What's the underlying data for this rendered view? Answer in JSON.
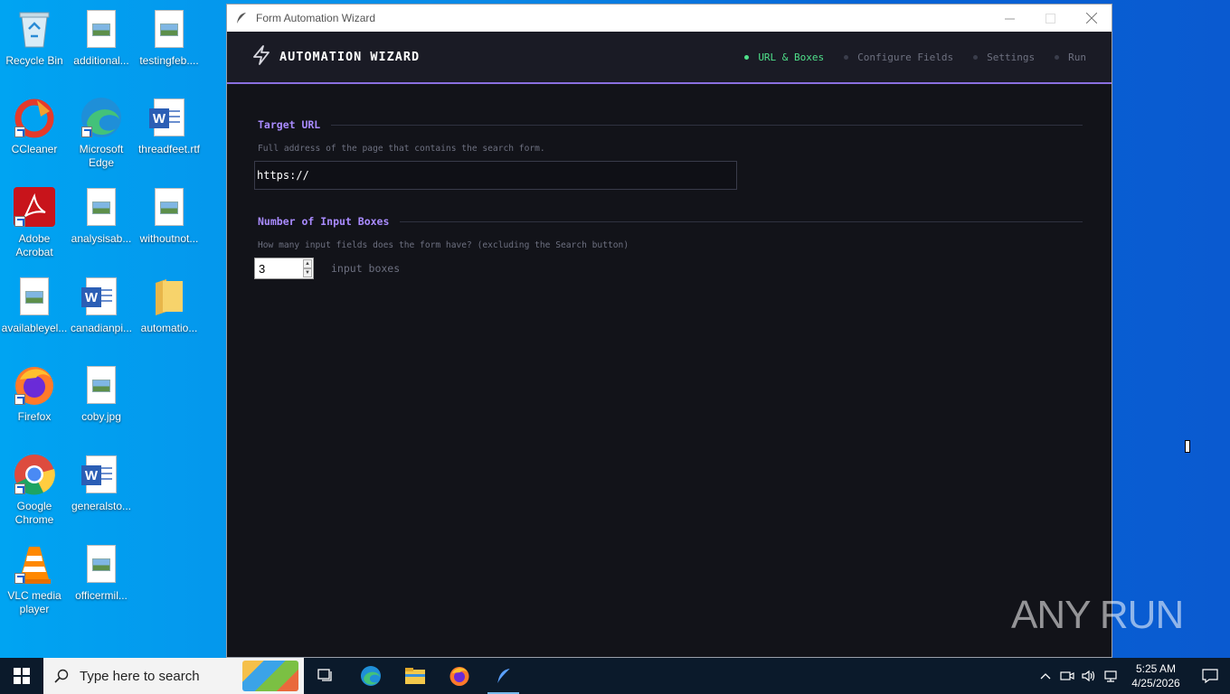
{
  "desktop": {
    "icons": [
      {
        "label": "Recycle Bin",
        "icon": "recycle-bin-icon"
      },
      {
        "label": "additional...",
        "icon": "image-file-icon"
      },
      {
        "label": "testingfeb....",
        "icon": "image-file-icon"
      },
      {
        "label": "CCleaner",
        "icon": "ccleaner-icon"
      },
      {
        "label": "Microsoft Edge",
        "icon": "edge-icon"
      },
      {
        "label": "threadfeet.rtf",
        "icon": "word-file-icon"
      },
      {
        "label": "Adobe Acrobat",
        "icon": "acrobat-icon"
      },
      {
        "label": "analysisab...",
        "icon": "image-file-icon"
      },
      {
        "label": "withoutnot...",
        "icon": "image-file-icon"
      },
      {
        "label": "availableyel...",
        "icon": "image-file-icon"
      },
      {
        "label": "canadianpi...",
        "icon": "word-file-icon"
      },
      {
        "label": "automatio...",
        "icon": "folder-icon"
      },
      {
        "label": "Firefox",
        "icon": "firefox-icon"
      },
      {
        "label": "coby.jpg",
        "icon": "image-file-icon"
      },
      {
        "label": "Google Chrome",
        "icon": "chrome-icon"
      },
      {
        "label": "generalsto...",
        "icon": "word-file-icon"
      },
      {
        "label": "VLC media player",
        "icon": "vlc-icon"
      },
      {
        "label": "officermil...",
        "icon": "image-file-icon"
      }
    ]
  },
  "window": {
    "title": "Form Automation Wizard",
    "header": {
      "brand": "AUTOMATION WIZARD",
      "steps": [
        {
          "label": "URL & Boxes",
          "active": true
        },
        {
          "label": "Configure Fields",
          "active": false
        },
        {
          "label": "Settings",
          "active": false
        },
        {
          "label": "Run",
          "active": false
        }
      ]
    },
    "url_section": {
      "title": "Target URL",
      "hint": "Full address of the page that contains the search form.",
      "value": "https://"
    },
    "boxes_section": {
      "title": "Number of Input Boxes",
      "hint": "How many input fields does the form have? (excluding the Search button)",
      "value": "3",
      "unit": "input boxes"
    }
  },
  "watermark": "ANY RUN",
  "taskbar": {
    "search_placeholder": "Type here to search",
    "time": "5:25 AM",
    "date": "4/25/2026"
  },
  "colors": {
    "accent": "#a98bff",
    "active_step": "#4fe08a",
    "window_bg": "#121319"
  }
}
